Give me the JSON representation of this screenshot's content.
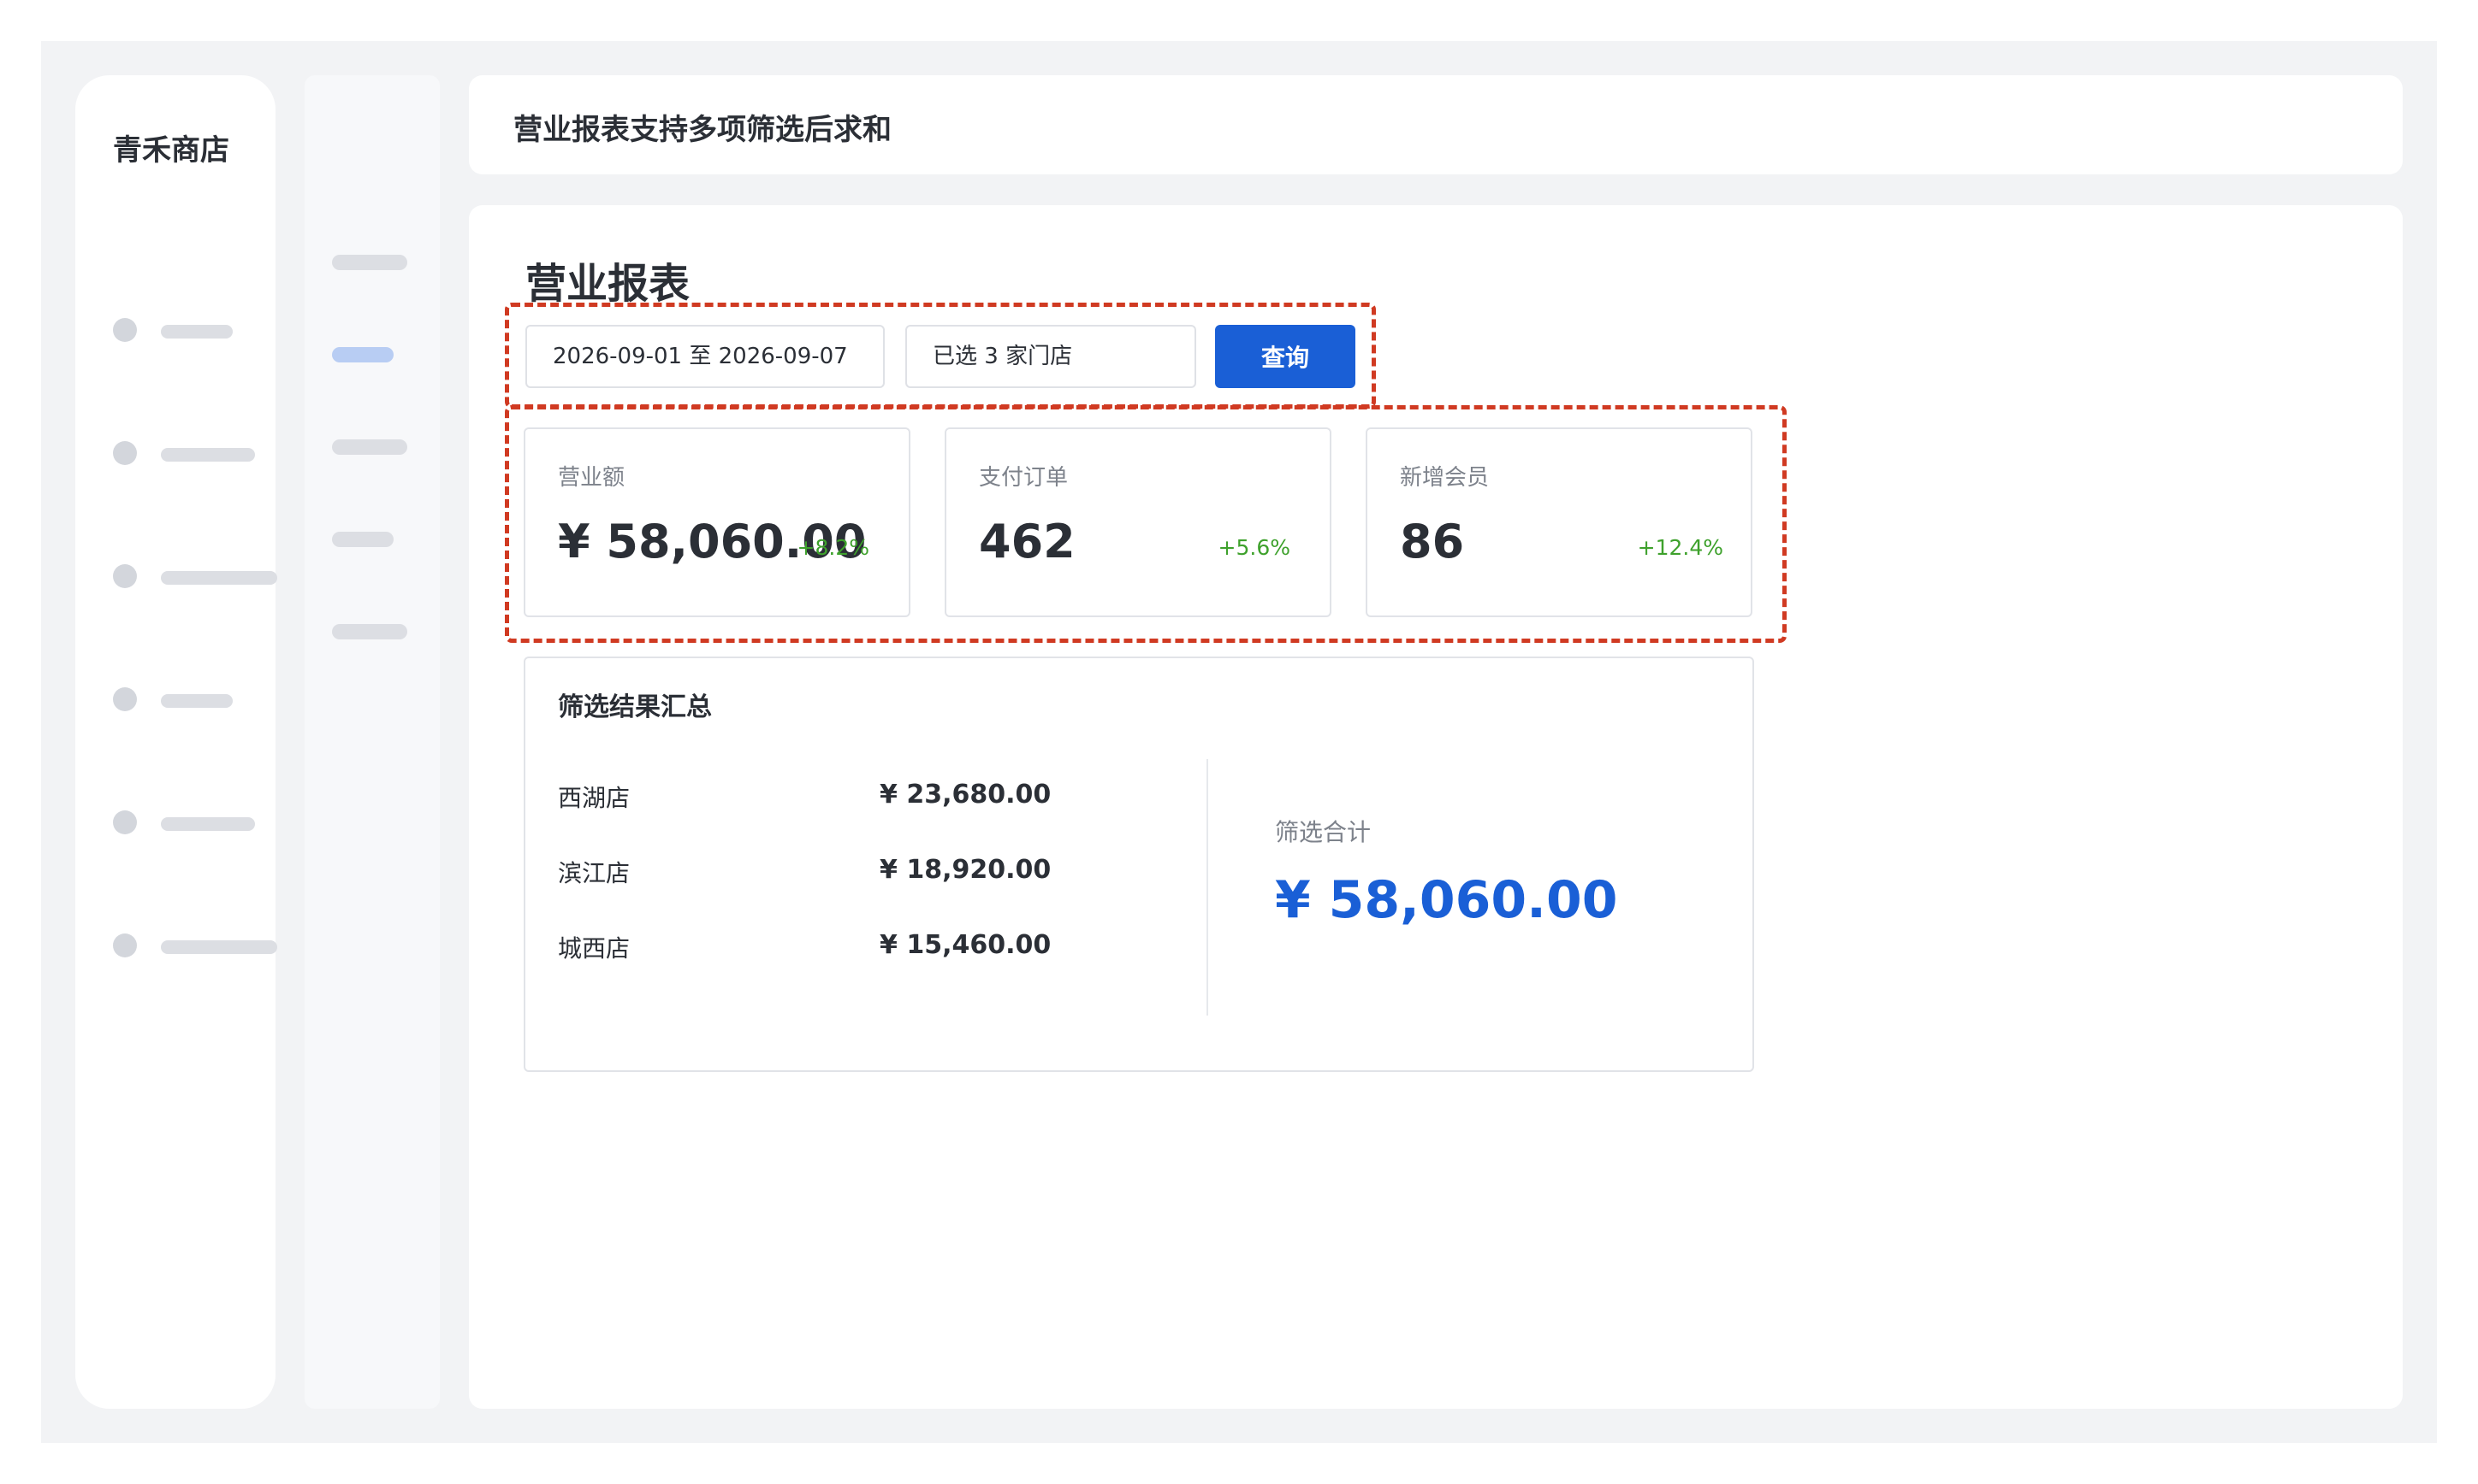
{
  "sidebar": {
    "brand": "青禾商店",
    "item_count": 6
  },
  "header": {
    "title": "营业报表支持多项筛选后求和"
  },
  "page": {
    "title": "营业报表"
  },
  "filters": {
    "date_range": "2026-09-01 至 2026-09-07",
    "stores": "已选 3 家门店",
    "query_label": "查询"
  },
  "kpis": [
    {
      "label": "营业额",
      "value": "¥ 58,060.00",
      "delta": "+8.2%"
    },
    {
      "label": "支付订单",
      "value": "462",
      "delta": "+5.6%"
    },
    {
      "label": "新增会员",
      "value": "86",
      "delta": "+12.4%"
    }
  ],
  "summary": {
    "title": "筛选结果汇总",
    "stores": [
      {
        "name": "西湖店",
        "amount": "¥ 23,680.00"
      },
      {
        "name": "滨江店",
        "amount": "¥ 18,920.00"
      },
      {
        "name": "城西店",
        "amount": "¥ 15,460.00"
      }
    ],
    "total_label": "筛选合计",
    "total_value": "¥ 58,060.00"
  },
  "colors": {
    "accent": "#1a5fd6",
    "positive": "#3ea12c",
    "highlight_dash": "#d03a22",
    "background": "#f2f3f5"
  }
}
